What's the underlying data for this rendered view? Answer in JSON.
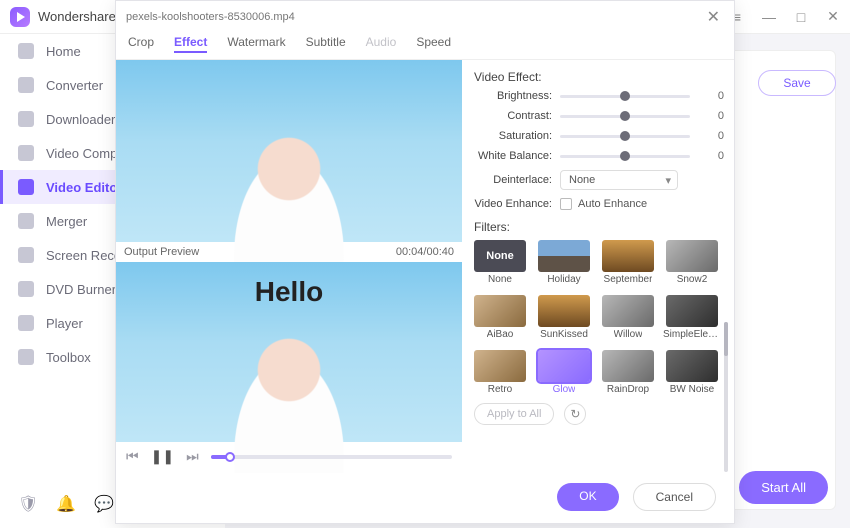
{
  "brand": "Wondershare",
  "window_controls": {
    "menu": "≡",
    "minimize": "—",
    "maximize": "□",
    "close": "✕"
  },
  "sidebar": {
    "items": [
      {
        "label": "Home"
      },
      {
        "label": "Converter"
      },
      {
        "label": "Downloader"
      },
      {
        "label": "Video Compressor"
      },
      {
        "label": "Video Editor"
      },
      {
        "label": "Merger"
      },
      {
        "label": "Screen Recorder"
      },
      {
        "label": "DVD Burner"
      },
      {
        "label": "Player"
      },
      {
        "label": "Toolbox"
      }
    ]
  },
  "back": {
    "save": "Save",
    "start_all": "Start All"
  },
  "modal": {
    "filename": "pexels-koolshooters-8530006.mp4",
    "tabs": [
      "Crop",
      "Effect",
      "Watermark",
      "Subtitle",
      "Audio",
      "Speed"
    ],
    "preview": {
      "output_label": "Output Preview",
      "time": "00:04/00:40",
      "hello": "Hello"
    },
    "effect": {
      "section_title": "Video Effect:",
      "sliders": {
        "brightness": {
          "label": "Brightness:",
          "value": "0"
        },
        "contrast": {
          "label": "Contrast:",
          "value": "0"
        },
        "saturation": {
          "label": "Saturation:",
          "value": "0"
        },
        "white": {
          "label": "White Balance:",
          "value": "0"
        }
      },
      "deinterlace": {
        "label": "Deinterlace:",
        "value": "None"
      },
      "enhance": {
        "label": "Video Enhance:",
        "checkbox_label": "Auto Enhance"
      }
    },
    "filters": {
      "title": "Filters:",
      "none_text": "None",
      "items": [
        {
          "name": "None"
        },
        {
          "name": "Holiday"
        },
        {
          "name": "September"
        },
        {
          "name": "Snow2"
        },
        {
          "name": "AiBao"
        },
        {
          "name": "SunKissed"
        },
        {
          "name": "Willow"
        },
        {
          "name": "SimpleElegant"
        },
        {
          "name": "Retro"
        },
        {
          "name": "Glow"
        },
        {
          "name": "RainDrop"
        },
        {
          "name": "BW Noise"
        }
      ],
      "apply_all": "Apply to All"
    },
    "buttons": {
      "ok": "OK",
      "cancel": "Cancel"
    }
  }
}
